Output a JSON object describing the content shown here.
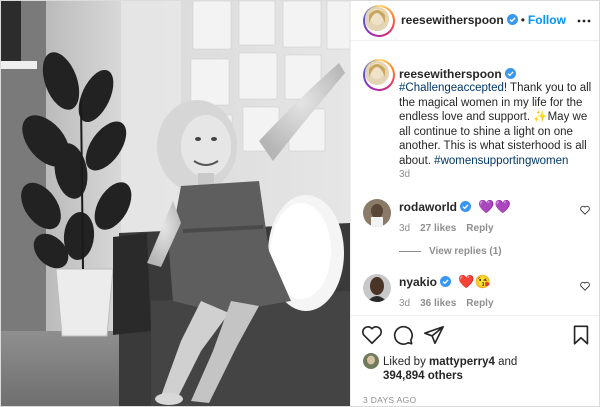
{
  "header": {
    "username": "reesewitherspoon",
    "separator": "•",
    "follow_label": "Follow",
    "more_icon": "more-options-icon"
  },
  "caption": {
    "username": "reesewitherspoon",
    "hashtag_1": "#Challengeaccepted",
    "text_1": "! Thank you to all the magical women in my life for the endless love and support. ",
    "sparkle": "✨",
    "text_2": "May we all continue to shine a light on one another. This is what sisterhood is all about. ",
    "hashtag_2": "#womensupportingwomen",
    "time": "3d"
  },
  "comments": [
    {
      "username": "rodaworld",
      "emoji": "💜💜",
      "time": "3d",
      "likes": "27 likes",
      "reply_label": "Reply",
      "replies_label": "View replies (1)"
    },
    {
      "username": "nyakio",
      "emoji": "❤️😘",
      "time": "3d",
      "likes": "36 likes",
      "reply_label": "Reply"
    }
  ],
  "actions": {
    "like_icon": "heart-icon",
    "comment_icon": "comment-icon",
    "share_icon": "send-icon",
    "save_icon": "bookmark-icon"
  },
  "likes": {
    "prefix": "Liked by ",
    "user": "mattyperry4",
    "middle": " and",
    "count": "394,894 others"
  },
  "post_date": "3 DAYS AGO",
  "colors": {
    "link_blue": "#0095f6",
    "hashtag": "#00376b",
    "muted": "#8e8e8e",
    "text": "#262626",
    "border": "#efefef"
  }
}
